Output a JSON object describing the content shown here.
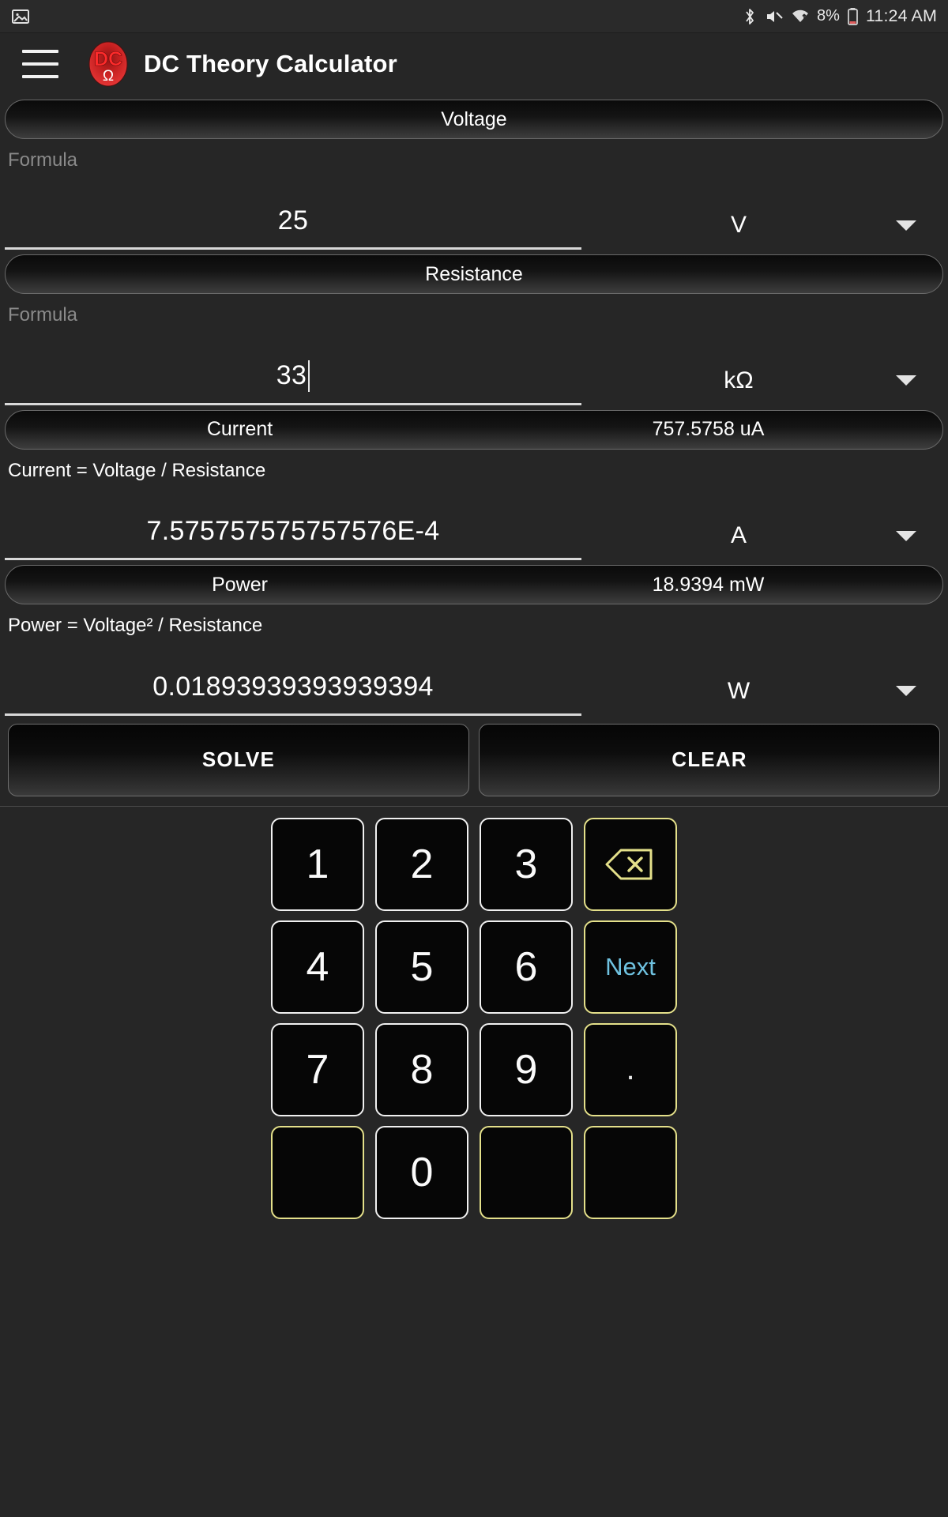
{
  "statusbar": {
    "left_icons": [
      {
        "name": "image-icon",
        "glyph": "ὛC"
      }
    ],
    "bluetooth_icon": "bluetooth-icon",
    "mute_icon": "volume-mute-icon",
    "wifi_icon": "wifi-icon",
    "battery_percent": "8%",
    "battery_icon": "battery-icon",
    "time": "11:24 AM"
  },
  "appbar": {
    "menu_icon": "hamburger-menu-icon",
    "logo_icon": "dc-omega-logo-icon",
    "logo_text": "DC",
    "logo_symbol": "Ω",
    "title": "DC Theory Calculator"
  },
  "fields": [
    {
      "id": "voltage",
      "pill_label": "Voltage",
      "pill_value": "",
      "formula": "Formula",
      "formula_dim": true,
      "value": "25",
      "has_caret": false,
      "unit": "V",
      "dropdown_icon": "chevron-down-icon"
    },
    {
      "id": "resistance",
      "pill_label": "Resistance",
      "pill_value": "",
      "formula": "Formula",
      "formula_dim": true,
      "value": "33",
      "has_caret": true,
      "unit": "kΩ",
      "dropdown_icon": "chevron-down-icon"
    },
    {
      "id": "current",
      "pill_label": "Current",
      "pill_value": "757.5758 uA",
      "formula": "Current = Voltage / Resistance",
      "formula_dim": false,
      "value": "7.575757575757576E-4",
      "has_caret": false,
      "unit": "A",
      "dropdown_icon": "chevron-down-icon"
    },
    {
      "id": "power",
      "pill_label": "Power",
      "pill_value": "18.9394 mW",
      "formula": "Power = Voltage² / Resistance",
      "formula_dim": false,
      "value": "0.01893939393939394",
      "has_caret": false,
      "unit": "W",
      "dropdown_icon": "chevron-down-icon"
    }
  ],
  "actions": {
    "solve_label": "SOLVE",
    "clear_label": "CLEAR"
  },
  "keypad": {
    "rows": [
      [
        {
          "label": "1",
          "type": "digit"
        },
        {
          "label": "2",
          "type": "digit"
        },
        {
          "label": "3",
          "type": "digit"
        },
        {
          "label": "",
          "type": "backspace",
          "icon": "backspace-icon"
        }
      ],
      [
        {
          "label": "4",
          "type": "digit"
        },
        {
          "label": "5",
          "type": "digit"
        },
        {
          "label": "6",
          "type": "digit"
        },
        {
          "label": "Next",
          "type": "next"
        }
      ],
      [
        {
          "label": "7",
          "type": "digit"
        },
        {
          "label": "8",
          "type": "digit"
        },
        {
          "label": "9",
          "type": "digit"
        },
        {
          "label": ".",
          "type": "dot"
        }
      ],
      [
        {
          "label": "",
          "type": "blank-gold"
        },
        {
          "label": "0",
          "type": "digit"
        },
        {
          "label": "",
          "type": "blank-gold"
        },
        {
          "label": "",
          "type": "blank-gold"
        }
      ]
    ]
  },
  "colors": {
    "background": "#262626",
    "key_border_white": "#f0f0f0",
    "key_border_gold": "#e4e08a",
    "next_text": "#6fc2e0",
    "logo_red": "#d32020",
    "formula_dim": "#8a8a8a"
  }
}
